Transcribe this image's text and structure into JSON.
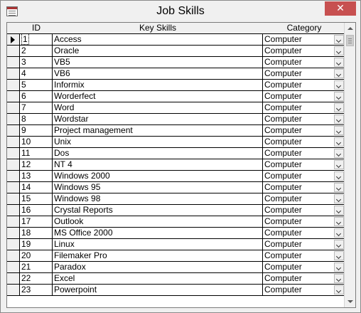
{
  "window": {
    "title": "Job Skills",
    "close_label": "✕"
  },
  "columns": {
    "id": "ID",
    "skill": "Key Skills",
    "category": "Category"
  },
  "rows": [
    {
      "id": "1",
      "skill": "Access",
      "category": "Computer"
    },
    {
      "id": "2",
      "skill": "Oracle",
      "category": "Computer"
    },
    {
      "id": "3",
      "skill": "VB5",
      "category": "Computer"
    },
    {
      "id": "4",
      "skill": "VB6",
      "category": "Computer"
    },
    {
      "id": "5",
      "skill": "Informix",
      "category": "Computer"
    },
    {
      "id": "6",
      "skill": "Worderfect",
      "category": "Computer"
    },
    {
      "id": "7",
      "skill": "Word",
      "category": "Computer"
    },
    {
      "id": "8",
      "skill": "Wordstar",
      "category": "Computer"
    },
    {
      "id": "9",
      "skill": "Project management",
      "category": "Computer"
    },
    {
      "id": "10",
      "skill": "Unix",
      "category": "Computer"
    },
    {
      "id": "11",
      "skill": "Dos",
      "category": "Computer"
    },
    {
      "id": "12",
      "skill": "NT 4",
      "category": "Computer"
    },
    {
      "id": "13",
      "skill": "Windows 2000",
      "category": "Computer"
    },
    {
      "id": "14",
      "skill": "Windows 95",
      "category": "Computer"
    },
    {
      "id": "15",
      "skill": "Windows 98",
      "category": "Computer"
    },
    {
      "id": "16",
      "skill": "Crystal Reports",
      "category": "Computer"
    },
    {
      "id": "17",
      "skill": "Outlook",
      "category": "Computer"
    },
    {
      "id": "18",
      "skill": "MS Office 2000",
      "category": "Computer"
    },
    {
      "id": "19",
      "skill": "Linux",
      "category": "Computer"
    },
    {
      "id": "20",
      "skill": "Filemaker Pro",
      "category": "Computer"
    },
    {
      "id": "21",
      "skill": "Paradox",
      "category": "Computer"
    },
    {
      "id": "22",
      "skill": "Excel",
      "category": "Computer"
    },
    {
      "id": "23",
      "skill": "Powerpoint",
      "category": "Computer"
    }
  ],
  "current_row_index": 0,
  "colors": {
    "close_button": "#c75050",
    "grid_lines": "#000000",
    "header_bg": "#f0f0f0"
  }
}
